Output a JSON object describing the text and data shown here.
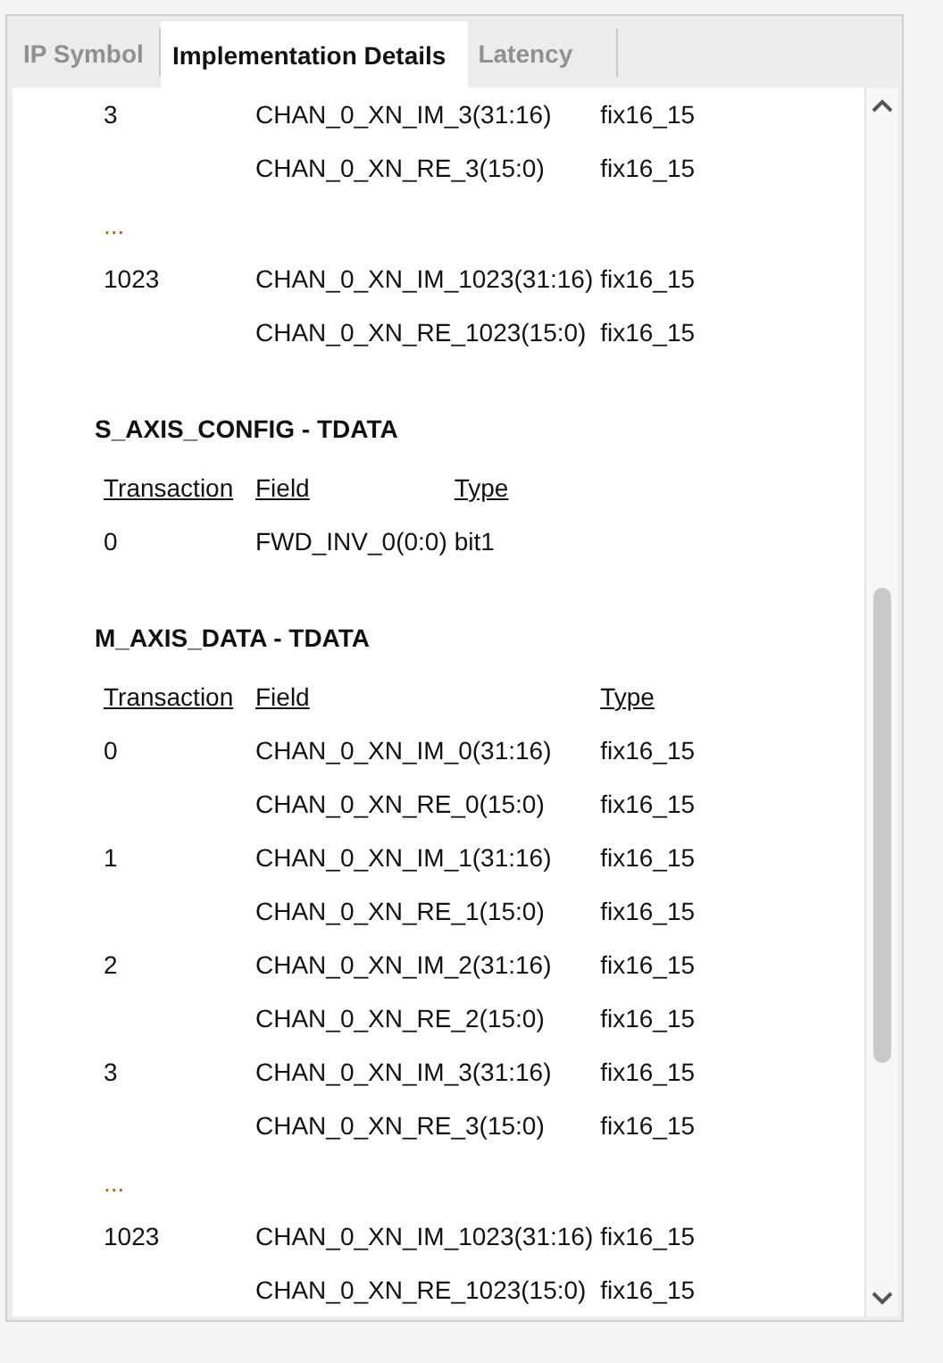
{
  "tabs": [
    {
      "label": "IP Symbol",
      "selected": false
    },
    {
      "label": "Implementation Details",
      "selected": true
    },
    {
      "label": "Latency",
      "selected": false
    }
  ],
  "sections": [
    {
      "rows": [
        {
          "kind": "data",
          "transaction": "3",
          "field": "CHAN_0_XN_IM_3(31:16)",
          "type": "fix16_15"
        },
        {
          "kind": "data",
          "field": "CHAN_0_XN_RE_3(15:0)",
          "type": "fix16_15"
        },
        {
          "kind": "ellipsis",
          "transaction": "..."
        },
        {
          "kind": "data",
          "transaction": "1023",
          "field": "CHAN_0_XN_IM_1023(31:16)",
          "type": "fix16_15"
        },
        {
          "kind": "data",
          "field": "CHAN_0_XN_RE_1023(15:0)",
          "type": "fix16_15"
        }
      ]
    },
    {
      "title": "S_AXIS_CONFIG - TDATA",
      "headers": [
        "Transaction",
        "Field",
        "Type"
      ],
      "rows": [
        {
          "kind": "data",
          "transaction": "0",
          "field": "FWD_INV_0(0:0)",
          "type": "bit1"
        }
      ]
    },
    {
      "title": "M_AXIS_DATA - TDATA",
      "headers": [
        "Transaction",
        "Field",
        "Type"
      ],
      "rows": [
        {
          "kind": "data",
          "transaction": "0",
          "field": "CHAN_0_XN_IM_0(31:16)",
          "type": "fix16_15"
        },
        {
          "kind": "data",
          "field": "CHAN_0_XN_RE_0(15:0)",
          "type": "fix16_15"
        },
        {
          "kind": "data",
          "transaction": "1",
          "field": "CHAN_0_XN_IM_1(31:16)",
          "type": "fix16_15"
        },
        {
          "kind": "data",
          "field": "CHAN_0_XN_RE_1(15:0)",
          "type": "fix16_15"
        },
        {
          "kind": "data",
          "transaction": "2",
          "field": "CHAN_0_XN_IM_2(31:16)",
          "type": "fix16_15"
        },
        {
          "kind": "data",
          "field": "CHAN_0_XN_RE_2(15:0)",
          "type": "fix16_15"
        },
        {
          "kind": "data",
          "transaction": "3",
          "field": "CHAN_0_XN_IM_3(31:16)",
          "type": "fix16_15"
        },
        {
          "kind": "data",
          "field": "CHAN_0_XN_RE_3(15:0)",
          "type": "fix16_15"
        },
        {
          "kind": "ellipsis",
          "transaction": "..."
        },
        {
          "kind": "data",
          "transaction": "1023",
          "field": "CHAN_0_XN_IM_1023(31:16)",
          "type": "fix16_15"
        },
        {
          "kind": "data",
          "field": "CHAN_0_XN_RE_1023(15:0)",
          "type": "fix16_15"
        }
      ]
    }
  ]
}
